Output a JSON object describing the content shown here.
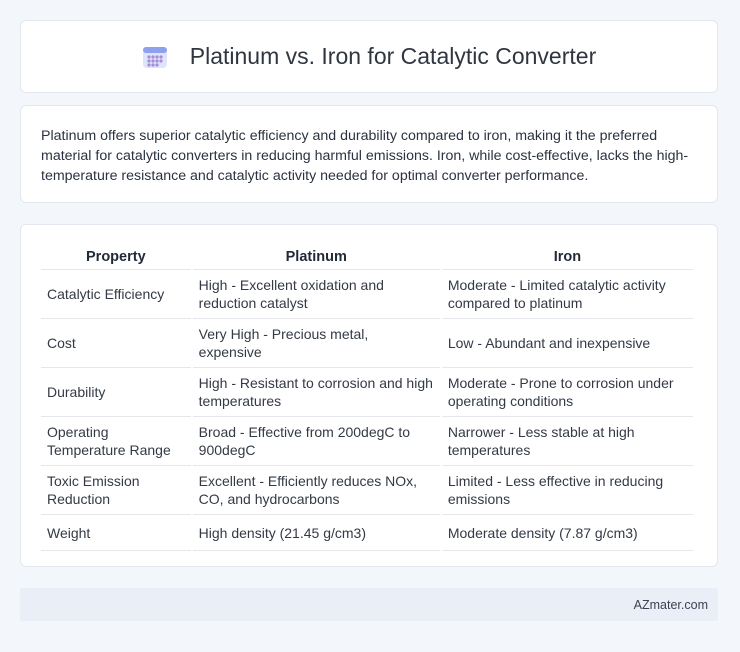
{
  "header": {
    "title": "Platinum vs. Iron for Catalytic Converter",
    "icon": "calendar-grid-icon"
  },
  "summary": {
    "text": "Platinum offers superior catalytic efficiency and durability compared to iron, making it the preferred material for catalytic converters in reducing harmful emissions. Iron, while cost-effective, lacks the high-temperature resistance and catalytic activity needed for optimal converter performance."
  },
  "table": {
    "headers": [
      "Property",
      "Platinum",
      "Iron"
    ],
    "rows": [
      [
        "Catalytic Efficiency",
        "High - Excellent oxidation and reduction catalyst",
        "Moderate - Limited catalytic activity compared to platinum"
      ],
      [
        "Cost",
        "Very High - Precious metal, expensive",
        "Low - Abundant and inexpensive"
      ],
      [
        "Durability",
        "High - Resistant to corrosion and high temperatures",
        "Moderate - Prone to corrosion under operating conditions"
      ],
      [
        "Operating Temperature Range",
        "Broad - Effective from 200degC to 900degC",
        "Narrower - Less stable at high temperatures"
      ],
      [
        "Toxic Emission Reduction",
        "Excellent - Efficiently reduces NOx, CO, and hydrocarbons",
        "Limited - Less effective in reducing emissions"
      ],
      [
        "Weight",
        "High density (21.45 g/cm3)",
        "Moderate density (7.87 g/cm3)"
      ]
    ]
  },
  "footer": {
    "brand": "AZmater.com"
  }
}
